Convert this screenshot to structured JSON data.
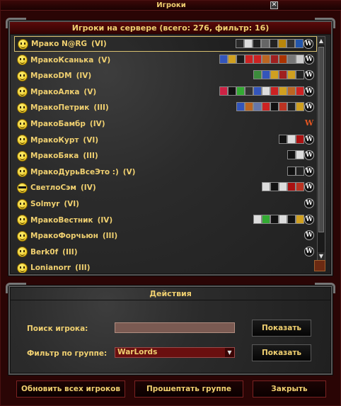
{
  "window": {
    "title": "Игроки"
  },
  "players": {
    "header": "Игроки на сервере (всего: 276, фильтр: 16)",
    "rows": [
      {
        "name": "Мрако N@RG",
        "level": "(VI)",
        "smiley": "smiley-icon",
        "selected": true,
        "badges": [
          "#2a2a2a",
          "#ddd",
          "#222",
          "#666",
          "#222",
          "#b8860b",
          "#333",
          "#2255aa",
          "w"
        ]
      },
      {
        "name": "МракоКсанька",
        "level": "(V)",
        "smiley": "smiley-icon",
        "badges": [
          "#3355bb",
          "#d0a020",
          "#1a1a1a",
          "#c22",
          "#c22",
          "#bb6622",
          "#a02020",
          "#aa3300",
          "#777",
          "#ccc",
          "w"
        ]
      },
      {
        "name": "МракоDM",
        "level": "(IV)",
        "smiley": "smiley-icon",
        "badges": [
          "#3b8b3b",
          "#3355bb",
          "#d0a020",
          "#a02020",
          "#d0a020",
          "#222",
          "w"
        ]
      },
      {
        "name": "МракоАлка",
        "level": "(V)",
        "smiley": "smiley-icon",
        "badges": [
          "#cc2244",
          "#111",
          "#33aa33",
          "#333",
          "#3355bb",
          "#ddd",
          "#c22",
          "#d0a020",
          "#bb6622",
          "#c22",
          "w"
        ]
      },
      {
        "name": "МракоПетрик",
        "level": "(III)",
        "smiley": "smiley-icon",
        "badges": [
          "#3355bb",
          "#bb6622",
          "#6677aa",
          "#c22",
          "#111",
          "#bb3322",
          "#222",
          "#d0a020",
          "w"
        ]
      },
      {
        "name": "МракоБамбр",
        "level": "(IV)",
        "smiley": "smiley-icon",
        "badges": [
          "wr"
        ]
      },
      {
        "name": "МракоКурт",
        "level": "(VI)",
        "smiley": "smiley-icon",
        "badges": [
          "#111",
          "#ddd",
          "#aa1111",
          "w"
        ]
      },
      {
        "name": "МракоБяка",
        "level": "(III)",
        "smiley": "smiley-icon",
        "badges": [
          "#111",
          "#ddd",
          "w"
        ]
      },
      {
        "name": "МракоДурьВсеЭто :)",
        "level": "(V)",
        "smiley": "smiley-icon",
        "badges": [
          "#111",
          "#222",
          "w"
        ]
      },
      {
        "name": "СветлоСэм",
        "level": "(IV)",
        "smiley": "cool-smiley-icon",
        "badges": [
          "#ddd",
          "#111",
          "#ddd",
          "#aa1111",
          "#bb3322",
          "w"
        ]
      },
      {
        "name": "Solmyr",
        "level": "(VI)",
        "smiley": "smiley-icon",
        "badges": [
          "w"
        ]
      },
      {
        "name": "МракоВестник",
        "level": "(IV)",
        "smiley": "smiley-icon",
        "badges": [
          "#ddd",
          "#33aa33",
          "#111",
          "#ddd",
          "#111",
          "#d0a020",
          "w"
        ]
      },
      {
        "name": "МракоФорчьюн",
        "level": "(III)",
        "smiley": "smiley-icon",
        "badges": [
          "w"
        ]
      },
      {
        "name": "Berk0f",
        "level": "(III)",
        "smiley": "smiley-icon",
        "badges": [
          "w"
        ]
      },
      {
        "name": "Lonianorr",
        "level": "(III)",
        "smiley": "smiley-icon",
        "badges": []
      }
    ]
  },
  "actions": {
    "header": "Действия",
    "search_label": "Поиск игрока:",
    "search_value": "",
    "search_button": "Показать",
    "filter_label": "Фильтр по группе:",
    "filter_value": "WarLords",
    "filter_button": "Показать"
  },
  "footer": {
    "refresh_button": "Обновить всех игроков",
    "whisper_button": "Прошептать группе",
    "close_button": "Закрыть"
  }
}
